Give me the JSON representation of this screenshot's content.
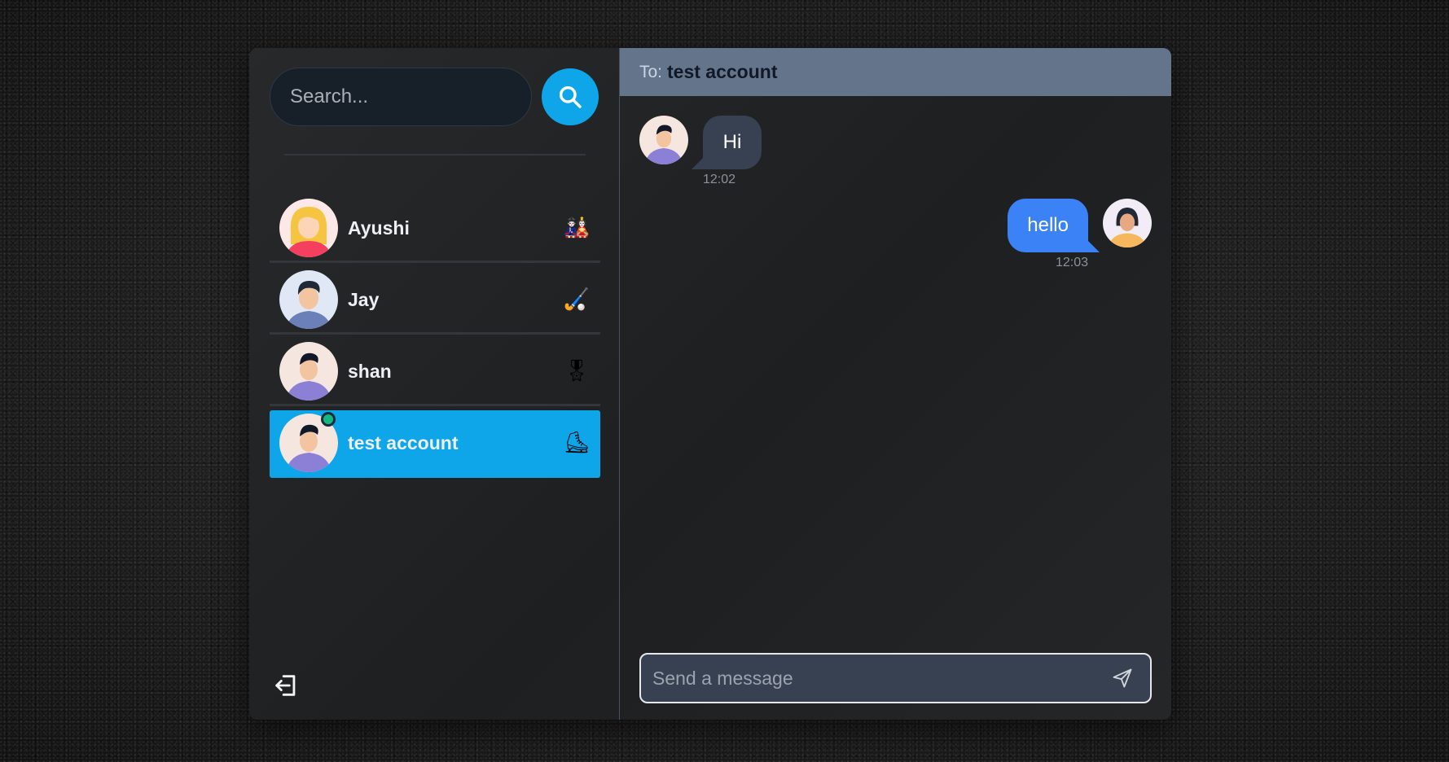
{
  "search": {
    "placeholder": "Search...",
    "button_icon": "search-icon"
  },
  "colors": {
    "accent": "#0ea5e9",
    "header": "#64748b",
    "outgoing": "#3b82f6",
    "incoming": "#374151",
    "online": "#10b981"
  },
  "contacts": [
    {
      "name": "Ayushi",
      "emoji": "🎎",
      "avatar": "woman-blonde",
      "active": false,
      "online": false
    },
    {
      "name": "Jay",
      "emoji": "🏑",
      "avatar": "man-blue-shirt",
      "active": false,
      "online": false
    },
    {
      "name": "shan",
      "emoji": "🎖",
      "avatar": "man-purple-hoodie",
      "active": false,
      "online": false
    },
    {
      "name": "test account",
      "emoji": "⛸",
      "avatar": "man-purple-hoodie",
      "active": true,
      "online": true
    }
  ],
  "sidebar": {
    "logout_icon": "logout-icon"
  },
  "chat": {
    "to_label": "To:",
    "recipient": "test account",
    "messages": [
      {
        "direction": "incoming",
        "text": "Hi",
        "time": "12:02",
        "avatar": "man-purple-hoodie"
      },
      {
        "direction": "outgoing",
        "text": "hello",
        "time": "12:03",
        "avatar": "woman-dark-hair"
      }
    ],
    "composer_placeholder": "Send a message",
    "send_icon": "send-icon"
  }
}
